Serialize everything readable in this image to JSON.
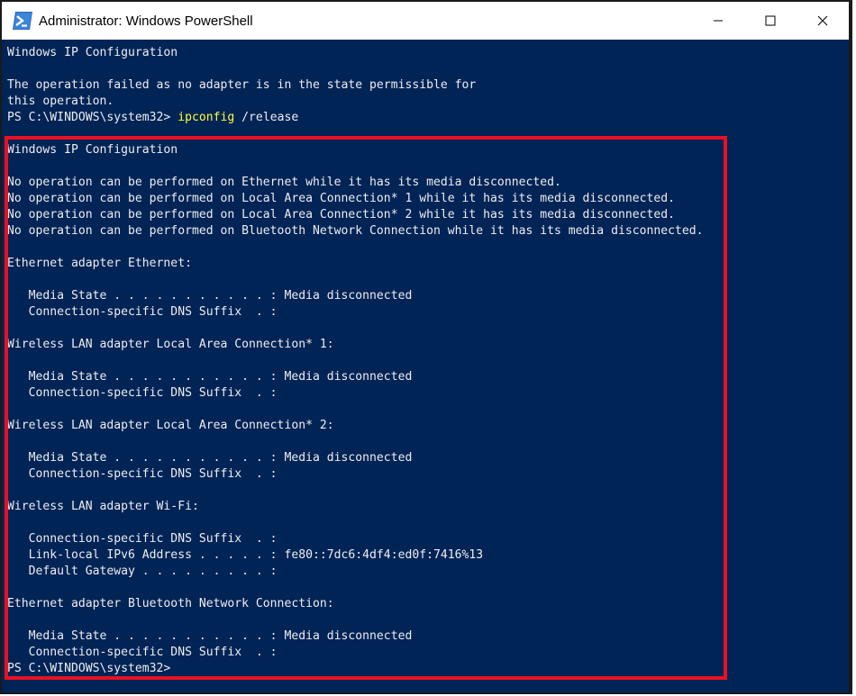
{
  "window": {
    "title": "Administrator: Windows PowerShell",
    "app_icon": "powershell-icon",
    "controls": {
      "minimize": "—",
      "maximize": "☐",
      "close": "✕"
    }
  },
  "console": {
    "lines": [
      "Windows IP Configuration",
      "",
      "The operation failed as no adapter is in the state permissible for",
      "this operation.",
      "",
      "Windows IP Configuration",
      "",
      "No operation can be performed on Ethernet while it has its media disconnected.",
      "No operation can be performed on Local Area Connection* 1 while it has its media disconnected.",
      "No operation can be performed on Local Area Connection* 2 while it has its media disconnected.",
      "No operation can be performed on Bluetooth Network Connection while it has its media disconnected.",
      "",
      "Ethernet adapter Ethernet:",
      "",
      "   Media State . . . . . . . . . . . : Media disconnected",
      "   Connection-specific DNS Suffix  . :",
      "",
      "Wireless LAN adapter Local Area Connection* 1:",
      "",
      "   Media State . . . . . . . . . . . : Media disconnected",
      "   Connection-specific DNS Suffix  . :",
      "",
      "Wireless LAN adapter Local Area Connection* 2:",
      "",
      "   Media State . . . . . . . . . . . : Media disconnected",
      "   Connection-specific DNS Suffix  . :",
      "",
      "Wireless LAN adapter Wi-Fi:",
      "",
      "   Connection-specific DNS Suffix  . :",
      "   Link-local IPv6 Address . . . . . : fe80::7dc6:4df4:ed0f:7416%13",
      "   Default Gateway . . . . . . . . . :",
      "",
      "Ethernet adapter Bluetooth Network Connection:",
      "",
      "   Media State . . . . . . . . . . . : Media disconnected",
      "   Connection-specific DNS Suffix  . :",
      "PS C:\\WINDOWS\\system32>"
    ],
    "prompt_line": {
      "prompt": "PS C:\\WINDOWS\\system32> ",
      "command": "ipconfig",
      "args": " /release"
    },
    "colors": {
      "background": "#012456",
      "text": "#eeedf0",
      "command": "#fefe3c",
      "highlight": "#e81123"
    }
  }
}
